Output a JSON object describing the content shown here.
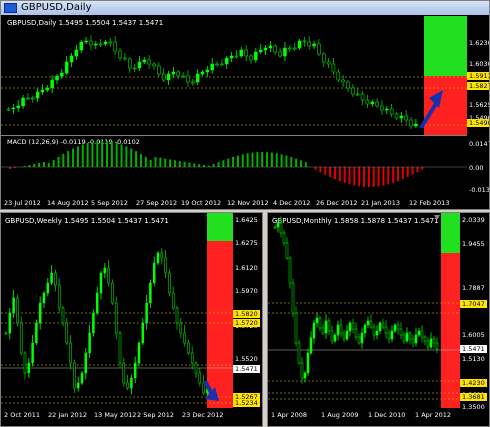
{
  "daily": {
    "title": "GBPUSD,Daily",
    "header": "GBPUSD,Daily  1.5495 1.5504 1.5437 1.5471",
    "macd_label": "MACD (12,26,9) -0.0119 -0.0119 -0.0102",
    "price_ticks": [
      "1.6230",
      "1.6030",
      "1.5625",
      "1.5490"
    ],
    "tags": [
      {
        "text": "1.5913",
        "kind": "yellow"
      },
      {
        "text": "1.5827",
        "kind": "yellow"
      },
      {
        "text": "1.5490",
        "kind": "yellow"
      }
    ],
    "macd_ticks": [
      "0.0147",
      "0.00",
      "-0.0131"
    ],
    "dates": [
      "23 Jul 2012",
      "14 Aug 2012",
      "5 Sep 2012",
      "27 Sep 2012",
      "19 Oct 2012",
      "12 Nov 2012",
      "4 Dec 2012",
      "26 Dec 2012",
      "21 Jan 2013",
      "12 Feb 2013"
    ]
  },
  "weekly": {
    "header": "GBPUSD,Weekly  1.5495 1.5504 1.5437 1.5471",
    "price_ticks": [
      "1.6425",
      "1.6275",
      "1.6120",
      "1.5970",
      "1.5820",
      "1.5720",
      "1.5520",
      "1.5471",
      "1.5234"
    ],
    "tags": [
      {
        "text": "1.5820",
        "kind": "yellow"
      },
      {
        "text": "1.5720",
        "kind": "yellow"
      },
      {
        "text": "1.5471",
        "kind": "white"
      },
      {
        "text": "1.5267",
        "kind": "yellow"
      },
      {
        "text": "1.5234",
        "kind": "yellow"
      }
    ],
    "dates": [
      "2 Oct 2011",
      "22 Jan 2012",
      "13 May 2012",
      "2 Sep 2012",
      "23 Dec 2012"
    ]
  },
  "monthly": {
    "header": "GBPUSD,Monthly  1.5858 1.5878 1.5437 1.5471",
    "price_ticks": [
      "2.0339",
      "1.9455",
      "1.7887",
      "1.6005",
      "1.5130",
      "1.4230",
      "1.3681",
      "1.3500"
    ],
    "tags": [
      {
        "text": "1.7047",
        "kind": "yellow"
      },
      {
        "text": "1.5471",
        "kind": "white"
      },
      {
        "text": "1.4230",
        "kind": "yellow"
      },
      {
        "text": "1.3681",
        "kind": "yellow"
      }
    ],
    "dates": [
      "1 Apr 2008",
      "1 Aug 2009",
      "1 Dec 2010",
      "1 Apr 2012"
    ]
  },
  "colors": {
    "bull": "#00ff00",
    "bear": "#00c000",
    "macd_pos": "#00b000",
    "macd_neg": "#e00000",
    "level": "#d8d800",
    "zone_red": "#ff2020",
    "zone_green": "#20e020",
    "arrow": "#1a2fb0"
  }
}
